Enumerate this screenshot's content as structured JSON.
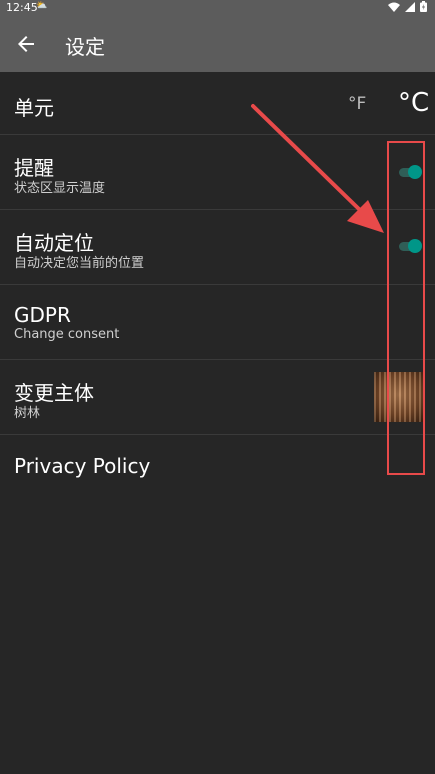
{
  "status_bar": {
    "time": "12:45",
    "left_icon": "notification-icon"
  },
  "app_bar": {
    "title": "设定",
    "back_icon": "arrow-back-icon"
  },
  "settings": {
    "unit": {
      "title": "单元",
      "option_f": "°F",
      "option_c": "°C",
      "selected": "°C"
    },
    "reminder": {
      "title": "提醒",
      "subtitle": "状态区显示温度",
      "enabled": true
    },
    "auto_locate": {
      "title": "自动定位",
      "subtitle": "自动决定您当前的位置",
      "enabled": true
    },
    "gdpr": {
      "title": "GDPR",
      "subtitle": "Change consent"
    },
    "theme": {
      "title": "变更主体",
      "subtitle": "树林"
    },
    "privacy": {
      "title": "Privacy Policy"
    }
  },
  "colors": {
    "accent": "#009688",
    "annotation": "#e84a4a",
    "background": "#262626",
    "app_bar": "#5c5c5c"
  }
}
